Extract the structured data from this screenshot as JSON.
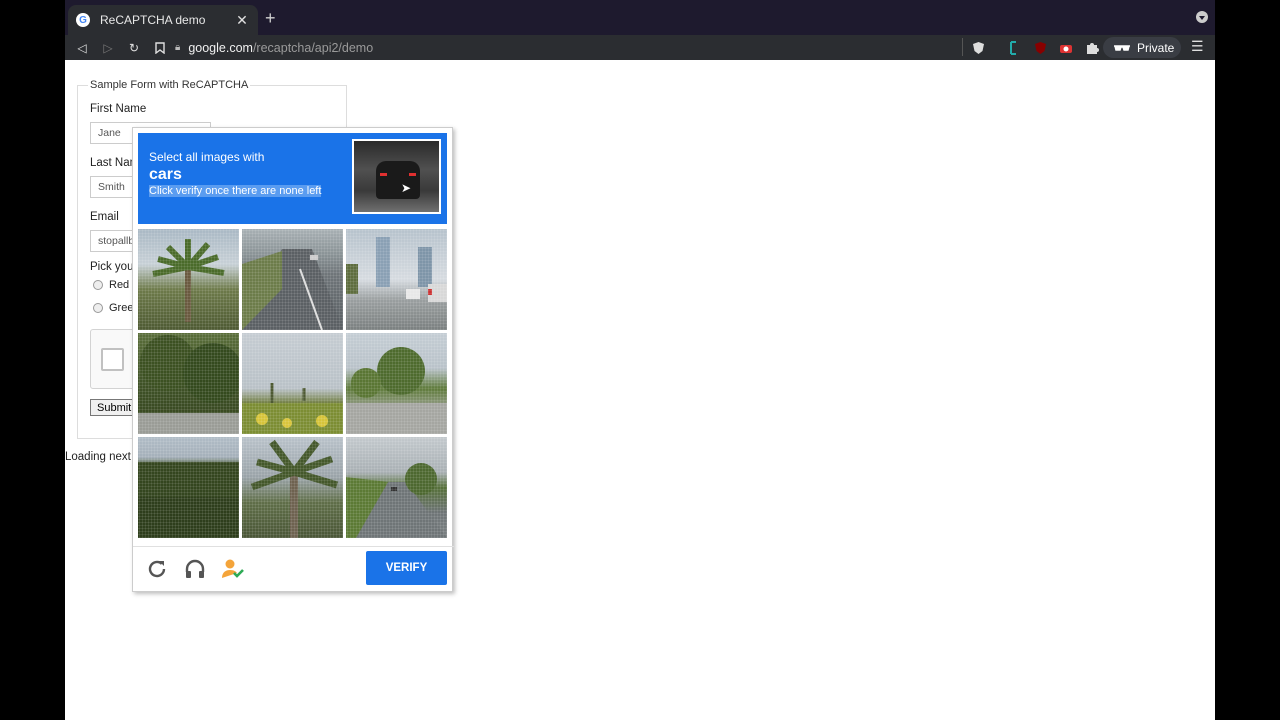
{
  "browser": {
    "tab_title": "ReCAPTCHA demo",
    "url_host": "google.com",
    "url_path": "/recaptcha/api2/demo",
    "private_label": "Private"
  },
  "form": {
    "legend": "Sample Form with ReCAPTCHA",
    "first_name_label": "First Name",
    "first_name_value": "Jane",
    "last_name_label": "Last Name",
    "last_name_value": "Smith",
    "email_label": "Email",
    "email_value": "stopallbots@gmail.com",
    "color_label": "Pick your favorite color:",
    "color_options": [
      "Red",
      "Green"
    ],
    "submit_label": "Submit"
  },
  "loading_text": "Loading next page...",
  "challenge": {
    "instruction_line1": "Select all images with",
    "keyword": "cars",
    "instruction_line3": "Click verify once there are none left",
    "verify_label": "VERIFY",
    "header_color": "#1a73e8"
  },
  "icons": {
    "reload": "reload-icon",
    "audio": "headphones-icon",
    "info": "user-check-icon"
  }
}
